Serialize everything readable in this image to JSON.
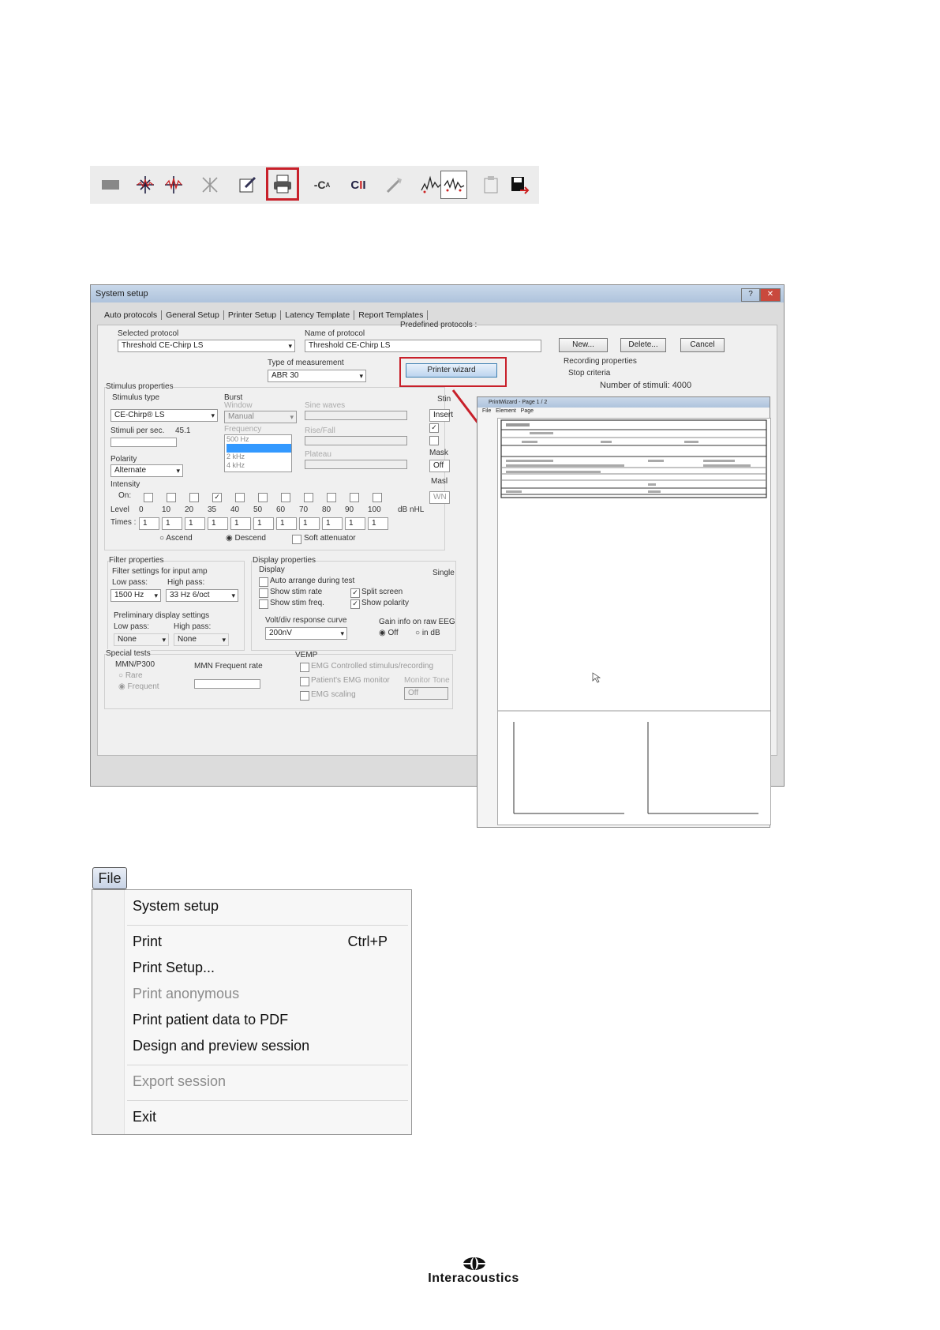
{
  "toolbar": {
    "icons": [
      "separator-icon",
      "collapse-icon",
      "expand-icon",
      "crossed-icon",
      "edit-report-icon",
      "print-icon",
      "cab-icon",
      "cii-icon",
      "marker-icon",
      "waveform-icon",
      "waveform-boxed-icon",
      "clipboard-icon",
      "save-exit-icon"
    ]
  },
  "system_setup": {
    "title": "System setup",
    "tabs": [
      "Auto protocols",
      "General Setup",
      "Printer Setup",
      "Latency Template",
      "Report Templates"
    ],
    "selected_protocol_label": "Selected protocol",
    "selected_protocol": "Threshold CE-Chirp LS",
    "name_of_protocol_label": "Name of protocol",
    "name_of_protocol": "Threshold CE-Chirp LS",
    "predefined_label": "Predefined protocols :",
    "buttons": {
      "new": "New...",
      "delete": "Delete...",
      "cancel": "Cancel",
      "printer_wizard": "Printer wizard"
    },
    "type_of_measurement_label": "Type of measurement",
    "type_of_measurement": "ABR 30",
    "recording_properties": "Recording properties",
    "stop_criteria": "Stop criteria",
    "number_of_stimuli": "Number of stimuli:  4000",
    "stimulus_properties": "Stimulus properties",
    "stimulus_type_label": "Stimulus type",
    "stimulus_type": "CE-Chirp® LS",
    "stimuli_per_sec_label": "Stimuli per sec.",
    "stimuli_per_sec": "45.1",
    "polarity_label": "Polarity",
    "polarity": "Alternate",
    "intensity_label": "Intensity",
    "burst_label": "Burst",
    "window_label": "Window",
    "window": "Manual",
    "frequency_label": "Frequency",
    "frequencies": [
      "500 Hz",
      "1 kHz",
      "2 kHz",
      "4 kHz"
    ],
    "sine_waves_label": "Sine waves",
    "rise_fall_label": "Rise/Fall",
    "plateau_label": "Plateau",
    "on_label": "On:",
    "level_label": "Level",
    "times_label": "Times :",
    "levels": [
      "0",
      "10",
      "20",
      "35",
      "40",
      "50",
      "60",
      "70",
      "80",
      "90",
      "100"
    ],
    "level_unit": "dB nHL",
    "times": [
      "1",
      "1",
      "1",
      "1",
      "1",
      "1",
      "1",
      "1",
      "1",
      "1",
      "1"
    ],
    "ascend": "Ascend",
    "descend": "Descend",
    "soft_attenuator": "Soft attenuator",
    "filter_properties": "Filter properties",
    "filter_settings_label": "Filter settings for input amp",
    "low_pass_label": "Low pass:",
    "high_pass_label": "High pass:",
    "low_pass": "1500 Hz",
    "high_pass": "33 Hz 6/oct",
    "preliminary_label": "Preliminary display settings",
    "prelim_low_pass_label": "Low pass:",
    "prelim_high_pass_label": "High pass:",
    "prelim_low": "None",
    "prelim_high": "None",
    "display_properties": "Display properties",
    "display_label": "Display",
    "auto_arrange": "Auto arrange during test",
    "show_stim_rate": "Show stim rate",
    "show_stim_freq": "Show stim freq.",
    "split_screen": "Split screen",
    "show_polarity": "Show polarity",
    "volt_div_label": "Volt/div response curve",
    "volt_div": "200nV",
    "gain_info_label": "Gain info on raw EEG",
    "gain_off": "Off",
    "gain_db": "in dB",
    "special_tests": "Special tests",
    "mmn_label": "MMN/P300",
    "rare": "Rare",
    "frequent": "Frequent",
    "mmn_rate_label": "MMN Frequent rate",
    "vemp_label": "VEMP",
    "emg_controlled": "EMG Controlled stimulus/recording",
    "patients_emg": "Patient's EMG monitor",
    "emg_scaling": "EMG scaling",
    "monitor_tone": "Monitor Tone",
    "monitor_tone_value": "Off",
    "stim_partial": "Stin",
    "insert_partial": "Insert",
    "mask_label": "Mask",
    "mask_value": "Off",
    "masl_label": "Masl",
    "wn_value": "WN",
    "single_label": "Single"
  },
  "print_wizard": {
    "title": "PrintWizard - Page 1 / 2",
    "menu": [
      "File",
      "Element",
      "Page"
    ]
  },
  "file_menu": {
    "button_label": "File",
    "items": [
      {
        "label": "System setup",
        "shortcut": "",
        "enabled": true
      },
      {
        "label": "Print",
        "shortcut": "Ctrl+P",
        "enabled": true
      },
      {
        "label": "Print Setup...",
        "shortcut": "",
        "enabled": true
      },
      {
        "label": "Print anonymous",
        "shortcut": "",
        "enabled": false
      },
      {
        "label": "Print patient data to PDF",
        "shortcut": "",
        "enabled": true
      },
      {
        "label": "Design and preview session",
        "shortcut": "",
        "enabled": true
      },
      {
        "label": "Export session",
        "shortcut": "",
        "enabled": false
      },
      {
        "label": "Exit",
        "shortcut": "",
        "enabled": true
      }
    ]
  },
  "logo": {
    "text": "Interacoustics"
  },
  "colors": {
    "highlight": "#c8202a",
    "arrow": "#c8202a"
  }
}
